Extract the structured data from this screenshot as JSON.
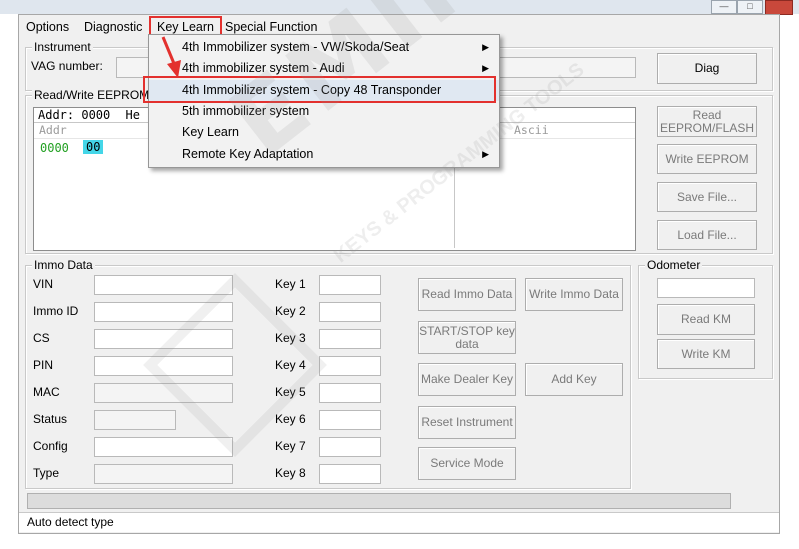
{
  "menubar": {
    "items": [
      "Options",
      "Diagnostic",
      "Key Learn",
      "Special Function"
    ]
  },
  "dropdown": {
    "items": [
      {
        "label": "4th Immobilizer system - VW/Skoda/Seat",
        "submenu": true
      },
      {
        "label": "4th immobilizer system - Audi",
        "submenu": true
      },
      {
        "label": "4th Immobilizer system - Copy 48 Transponder",
        "submenu": false
      },
      {
        "label": "5th immobilizer system",
        "submenu": false
      },
      {
        "label": "Key Learn",
        "submenu": false
      },
      {
        "label": "Remote Key Adaptation",
        "submenu": true
      }
    ],
    "highlight_color": "#e3312e"
  },
  "instrument": {
    "title": "Instrument",
    "vag_label": "VAG number:",
    "vag_value": "",
    "diag_button": "Diag"
  },
  "eeprom": {
    "title": "Read/Write EEPROM",
    "addr_label": "Addr:",
    "addr_value": "0000",
    "hex_label": "He",
    "col_addr": "Addr",
    "col_ascii": "Ascii",
    "row_addr": "0000",
    "row_cell": "00",
    "buttons": {
      "read": "Read EEPROM/FLASH",
      "write": "Write EEPROM",
      "save": "Save File...",
      "load": "Load File..."
    }
  },
  "immo": {
    "title": "Immo Data",
    "labels": [
      "VIN",
      "Immo ID",
      "CS",
      "PIN",
      "MAC",
      "Status",
      "Config",
      "Type"
    ],
    "keys": [
      "Key 1",
      "Key 2",
      "Key 3",
      "Key 4",
      "Key 5",
      "Key 6",
      "Key 7",
      "Key 8"
    ],
    "buttons": {
      "read_immo": "Read Immo Data",
      "write_immo": "Write Immo Data",
      "start_stop": "START/STOP key data",
      "make_dealer": "Make Dealer Key",
      "add_key": "Add Key",
      "reset_instrument": "Reset Instrument",
      "service_mode": "Service Mode"
    }
  },
  "odometer": {
    "title": "Odometer",
    "value": "",
    "read": "Read KM",
    "write": "Write KM"
  },
  "status": {
    "text": "Auto detect type"
  },
  "watermark": {
    "text": "EMIRATES",
    "tag": "KEYS & PROGRAMMING TOOLS"
  }
}
